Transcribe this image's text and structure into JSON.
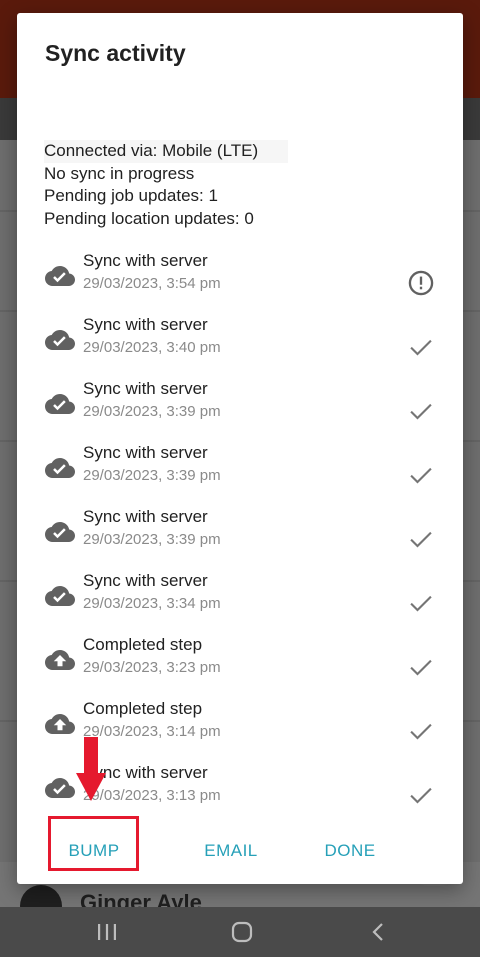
{
  "background": {
    "contact_name": "Ginger Ayle"
  },
  "dialog": {
    "title": "Sync activity",
    "status_lines": [
      "Connected via: Mobile (LTE)",
      "No sync in progress",
      "Pending job updates: 1",
      "Pending location updates: 0"
    ],
    "items": [
      {
        "title": "Sync with server",
        "time": "29/03/2023, 3:54 pm",
        "icon": "cloud-done-icon",
        "status": "warning-circle-icon"
      },
      {
        "title": "Sync with server",
        "time": "29/03/2023, 3:40 pm",
        "icon": "cloud-done-icon",
        "status": "checkmark-icon"
      },
      {
        "title": "Sync with server",
        "time": "29/03/2023, 3:39 pm",
        "icon": "cloud-done-icon",
        "status": "checkmark-icon"
      },
      {
        "title": "Sync with server",
        "time": "29/03/2023, 3:39 pm",
        "icon": "cloud-done-icon",
        "status": "checkmark-icon"
      },
      {
        "title": "Sync with server",
        "time": "29/03/2023, 3:39 pm",
        "icon": "cloud-done-icon",
        "status": "checkmark-icon"
      },
      {
        "title": "Sync with server",
        "time": "29/03/2023, 3:34 pm",
        "icon": "cloud-done-icon",
        "status": "checkmark-icon"
      },
      {
        "title": "Completed step",
        "time": "29/03/2023, 3:23 pm",
        "icon": "cloud-upload-icon",
        "status": "checkmark-icon"
      },
      {
        "title": "Completed step",
        "time": "29/03/2023, 3:14 pm",
        "icon": "cloud-upload-icon",
        "status": "checkmark-icon"
      },
      {
        "title": "Sync with server",
        "time": "29/03/2023, 3:13 pm",
        "icon": "cloud-done-icon",
        "status": "checkmark-icon"
      }
    ],
    "actions": {
      "bump": "BUMP",
      "email": "EMAIL",
      "done": "DONE"
    }
  },
  "colors": {
    "accent": "#26a0b8",
    "annotation": "#e5192e",
    "icon_gray": "#616161"
  },
  "navbar": {
    "recent_icon": "recent-apps-icon",
    "home_icon": "home-icon",
    "back_icon": "back-icon"
  }
}
